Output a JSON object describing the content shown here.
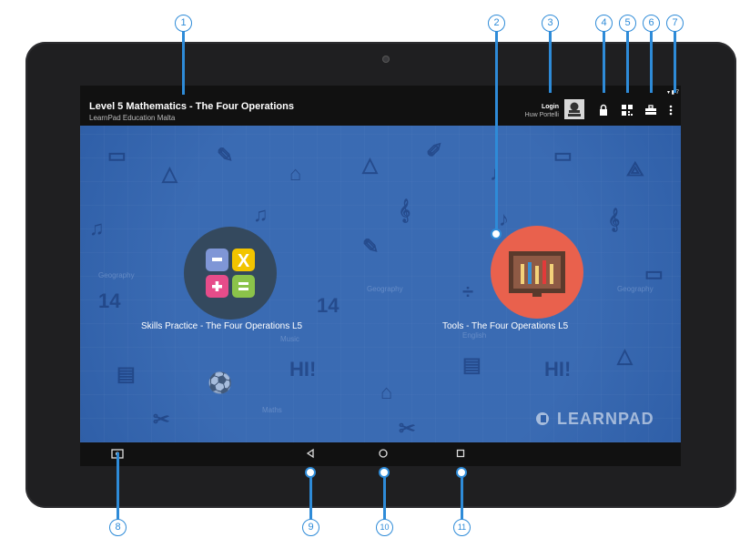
{
  "header": {
    "title": "Level 5 Mathematics - The Four Operations",
    "subtitle": "LearnPad Education Malta",
    "login_label": "Login",
    "login_user": "Huw Portelli"
  },
  "apps": [
    {
      "label": "Skills Practice - The Four Operations L5",
      "icon": "calculator-icon"
    },
    {
      "label": "Tools - The Four Operations L5",
      "icon": "paint-tools-icon"
    }
  ],
  "watermark": "LEARNPAD",
  "callouts": [
    "1",
    "2",
    "3",
    "4",
    "5",
    "6",
    "7",
    "8",
    "9",
    "10",
    "11"
  ],
  "icons": {
    "lock": "lock-icon",
    "qr": "qr-code-icon",
    "toolbox": "toolbox-icon",
    "menu": "overflow-menu-icon",
    "screenshot": "screenshot-icon",
    "back": "back-icon",
    "home": "home-icon",
    "recents": "recents-icon"
  },
  "colors": {
    "accent": "#2e8bd8",
    "background": "#2f5fa8",
    "skills_circle": "#34495e",
    "tools_circle": "#e9614d"
  }
}
